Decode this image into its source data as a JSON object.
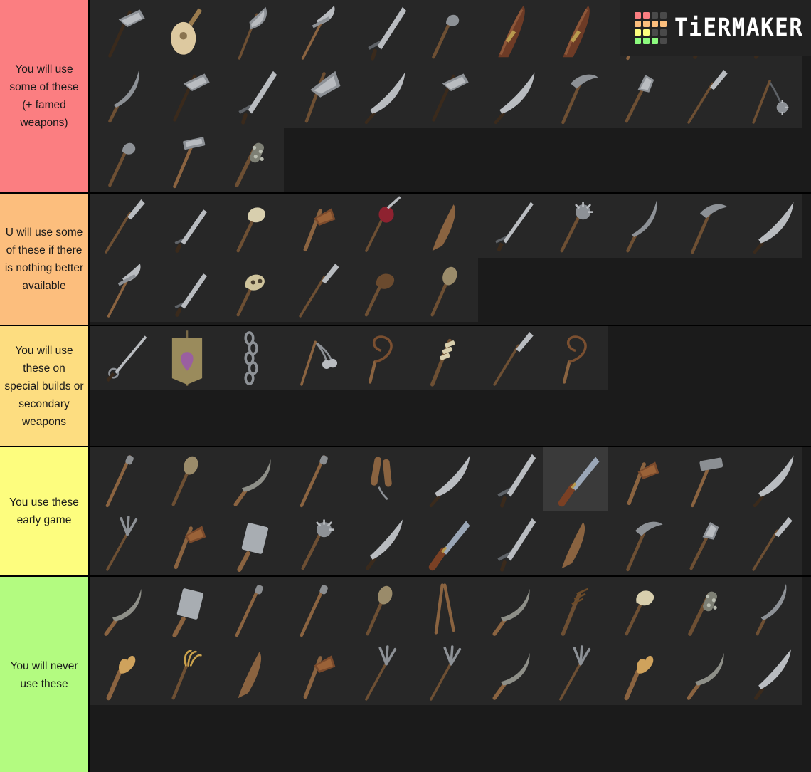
{
  "app": {
    "name": "TierMaker",
    "logo_word": "TiERMAKER",
    "logo_grid_colors": [
      "#fb7e81",
      "#fb7e81",
      "#4a4a4a",
      "#4a4a4a",
      "#fcbe7d",
      "#fcbe7d",
      "#fcbe7d",
      "#fcbe7d",
      "#fdfd7e",
      "#fdfd7e",
      "#4a4a4a",
      "#4a4a4a",
      "#8cfa7e",
      "#8cfa7e",
      "#8cfa7e",
      "#4a4a4a"
    ]
  },
  "board": {
    "background": "#1b1b1b",
    "cell_background": "#272727",
    "cell_selected_background": "#3a3a3a",
    "border_color": "#000000",
    "tiers": [
      {
        "id": "tier-s",
        "label": "You will use some of these (+ famed weapons)",
        "color": "#fb7e81",
        "text_color": "#1a1a1a",
        "item_count": 25,
        "items": [
          {
            "name": "double-bearded-axe",
            "icon": "axe"
          },
          {
            "name": "lute",
            "icon": "lute"
          },
          {
            "name": "bardiche",
            "icon": "bardiche"
          },
          {
            "name": "glaive",
            "icon": "glaive"
          },
          {
            "name": "longsword",
            "icon": "sword"
          },
          {
            "name": "mace",
            "icon": "mace"
          },
          {
            "name": "sheathed-sword",
            "icon": "scabbard"
          },
          {
            "name": "sheathed-sword-2",
            "icon": "scabbard"
          },
          {
            "name": "war-hammer",
            "icon": "warhammer"
          },
          {
            "name": "dagger",
            "icon": "dagger"
          },
          {
            "name": "falchion",
            "icon": "falchion"
          },
          {
            "name": "falx",
            "icon": "falx"
          },
          {
            "name": "bearded-axe",
            "icon": "axe"
          },
          {
            "name": "arming-sword",
            "icon": "sword"
          },
          {
            "name": "great-axe",
            "icon": "greataxe"
          },
          {
            "name": "scimitar",
            "icon": "scimitar"
          },
          {
            "name": "horseman-axe",
            "icon": "axe"
          },
          {
            "name": "sabre",
            "icon": "scimitar"
          },
          {
            "name": "war-pick",
            "icon": "pick"
          },
          {
            "name": "flanged-mace",
            "icon": "flangedmace"
          },
          {
            "name": "boar-spear",
            "icon": "spear"
          },
          {
            "name": "ball-and-chain-flail",
            "icon": "flail"
          },
          {
            "name": "bludgeon",
            "icon": "mace"
          },
          {
            "name": "maul",
            "icon": "warhammer"
          },
          {
            "name": "spiked-club",
            "icon": "spikedclub"
          }
        ]
      },
      {
        "id": "tier-a",
        "label": "U will use some of these if there is nothing better available",
        "color": "#fcbe7d",
        "text_color": "#1a1a1a",
        "item_count": 17,
        "items": [
          {
            "name": "winged-spear",
            "icon": "spear"
          },
          {
            "name": "short-sword",
            "icon": "dagger"
          },
          {
            "name": "bone-club",
            "icon": "boneclub"
          },
          {
            "name": "hatchet",
            "icon": "hatchet"
          },
          {
            "name": "morning-star-staff",
            "icon": "redmace"
          },
          {
            "name": "wooden-club",
            "icon": "club"
          },
          {
            "name": "estoc",
            "icon": "estoc"
          },
          {
            "name": "spiked-mace",
            "icon": "spikedmace"
          },
          {
            "name": "curved-blade",
            "icon": "falx"
          },
          {
            "name": "peasant-pick",
            "icon": "pick"
          },
          {
            "name": "sabre-2",
            "icon": "scimitar"
          },
          {
            "name": "glaive-polearm",
            "icon": "glaive"
          },
          {
            "name": "long-knife",
            "icon": "dagger"
          },
          {
            "name": "skull-staff",
            "icon": "skullstaff"
          },
          {
            "name": "lance",
            "icon": "spear"
          },
          {
            "name": "fist-club",
            "icon": "fistclub"
          },
          {
            "name": "bulb-staff",
            "icon": "bulbstaff"
          }
        ]
      },
      {
        "id": "tier-b",
        "label": "You will use these on special builds or secondary weapons",
        "color": "#fddd80",
        "text_color": "#1a1a1a",
        "item_count": 8,
        "items": [
          {
            "name": "rapier",
            "icon": "rapier"
          },
          {
            "name": "banner",
            "icon": "banner"
          },
          {
            "name": "chain",
            "icon": "chain"
          },
          {
            "name": "chain-flail",
            "icon": "chainflail"
          },
          {
            "name": "whip",
            "icon": "whip"
          },
          {
            "name": "wrapped-club",
            "icon": "wrappedclub"
          },
          {
            "name": "winged-spear-2",
            "icon": "spear"
          },
          {
            "name": "coiled-whip",
            "icon": "whip"
          }
        ]
      },
      {
        "id": "tier-c",
        "label": "You use these early game",
        "color": "#fdfd7e",
        "text_color": "#1a1a1a",
        "item_count": 22,
        "selected_index": 7,
        "items": [
          {
            "name": "quarterstaff",
            "icon": "staff"
          },
          {
            "name": "bulb-mace",
            "icon": "bulbstaff"
          },
          {
            "name": "sickle",
            "icon": "sickle"
          },
          {
            "name": "wooden-rod",
            "icon": "staff"
          },
          {
            "name": "nunchaku",
            "icon": "nunchaku"
          },
          {
            "name": "thin-sabre",
            "icon": "scimitar"
          },
          {
            "name": "arming-sword-2",
            "icon": "sword"
          },
          {
            "name": "hunting-knife",
            "icon": "knife"
          },
          {
            "name": "wood-axe",
            "icon": "hatchet"
          },
          {
            "name": "mallet",
            "icon": "mallet"
          },
          {
            "name": "machete",
            "icon": "scimitar"
          },
          {
            "name": "pitch-fork-tool",
            "icon": "pitchfork"
          },
          {
            "name": "hewing-axe",
            "icon": "hatchet"
          },
          {
            "name": "cleaver",
            "icon": "cleaver"
          },
          {
            "name": "morning-star",
            "icon": "spikedmace"
          },
          {
            "name": "falchion-2",
            "icon": "falchion"
          },
          {
            "name": "butcher-knife",
            "icon": "knife"
          },
          {
            "name": "gladius",
            "icon": "sword"
          },
          {
            "name": "torch-club",
            "icon": "club"
          },
          {
            "name": "pick-axe",
            "icon": "pick"
          },
          {
            "name": "ringed-mace",
            "icon": "flangedmace"
          },
          {
            "name": "javelin",
            "icon": "spear"
          }
        ]
      },
      {
        "id": "tier-d",
        "label": "You will never use these",
        "color": "#b3fb80",
        "text_color": "#1a1a1a",
        "item_count": 21,
        "items": [
          {
            "name": "small-sickle",
            "icon": "sickle"
          },
          {
            "name": "meat-cleaver",
            "icon": "cleaver"
          },
          {
            "name": "thin-staff",
            "icon": "staff"
          },
          {
            "name": "knobbed-rod",
            "icon": "staff"
          },
          {
            "name": "bulb-rod",
            "icon": "bulbstaff"
          },
          {
            "name": "tongs",
            "icon": "tongs"
          },
          {
            "name": "scythe-blade",
            "icon": "sickle"
          },
          {
            "name": "bound-torch",
            "icon": "torch"
          },
          {
            "name": "bone-rattle",
            "icon": "boneclub"
          },
          {
            "name": "thorn-club",
            "icon": "spikedclub"
          },
          {
            "name": "curved-knife",
            "icon": "falx"
          },
          {
            "name": "antler-club",
            "icon": "antler"
          },
          {
            "name": "claw-staff",
            "icon": "clawstaff"
          },
          {
            "name": "wooden-bat",
            "icon": "club"
          },
          {
            "name": "hand-axe",
            "icon": "hatchet"
          },
          {
            "name": "trident-small",
            "icon": "pitchfork"
          },
          {
            "name": "pitchfork",
            "icon": "pitchfork"
          },
          {
            "name": "scythe",
            "icon": "sickle"
          },
          {
            "name": "trident",
            "icon": "pitchfork"
          },
          {
            "name": "boar-tusk-club",
            "icon": "antler"
          },
          {
            "name": "sickle-blade",
            "icon": "sickle"
          },
          {
            "name": "kopis",
            "icon": "falchion"
          }
        ]
      }
    ]
  }
}
